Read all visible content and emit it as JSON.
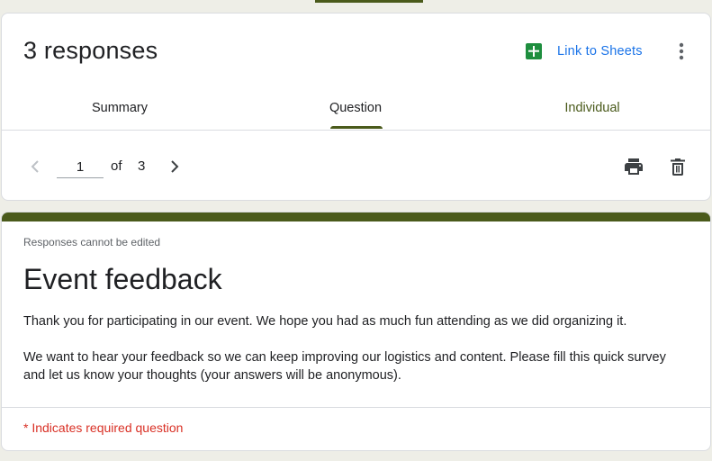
{
  "header": {
    "title": "3 responses",
    "link_sheets_label": "Link to Sheets"
  },
  "tabs": [
    {
      "label": "Summary",
      "active": false
    },
    {
      "label": "Question",
      "active": false
    },
    {
      "label": "Individual",
      "active": true
    }
  ],
  "pager": {
    "current": "1",
    "of_label": "of",
    "total": "3"
  },
  "form": {
    "notice": "Responses cannot be edited",
    "title": "Event feedback",
    "description": [
      "Thank you for participating in our event. We hope you had as much fun attending as we did organizing it.",
      "We want to hear your feedback so we can keep improving our logistics and content. Please fill this quick survey and let us know your thoughts (your answers will be anonymous)."
    ],
    "required_note": "* Indicates required question"
  },
  "icons": {
    "sheets": "sheets-icon",
    "more": "more-vert-icon",
    "prev": "chevron-left-icon",
    "next": "chevron-right-icon",
    "print": "print-icon",
    "delete": "trash-icon"
  },
  "colors": {
    "accent": "#4a5a1b",
    "link": "#1a73e8",
    "sheets_green": "#1e8e3e",
    "required": "#d93025",
    "background": "#eeeee7"
  }
}
